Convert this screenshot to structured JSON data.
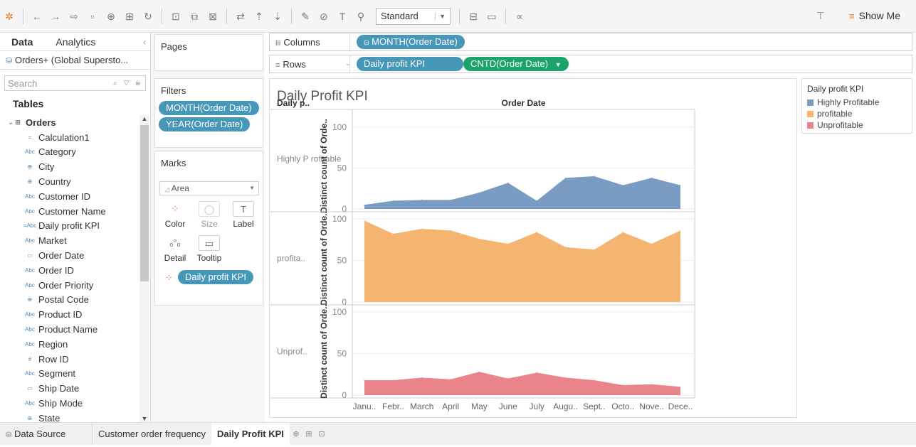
{
  "toolbar": {
    "fit_select": "Standard",
    "show_me_label": "Show Me"
  },
  "data_pane": {
    "tab_data": "Data",
    "tab_analytics": "Analytics",
    "data_source": "Orders+ (Global Supersto...",
    "search_placeholder": "Search",
    "tables_heading": "Tables",
    "fields": [
      {
        "label": "Orders",
        "icon": "table-icon",
        "group": true
      },
      {
        "label": "Calculation1",
        "icon": "calculated-field-icon"
      },
      {
        "label": "Category",
        "icon": "string-icon"
      },
      {
        "label": "City",
        "icon": "geo-icon"
      },
      {
        "label": "Country",
        "icon": "geo-icon"
      },
      {
        "label": "Customer ID",
        "icon": "string-icon"
      },
      {
        "label": "Customer Name",
        "icon": "string-icon"
      },
      {
        "label": "Daily profit KPI",
        "icon": "calc-string-icon"
      },
      {
        "label": "Market",
        "icon": "string-icon"
      },
      {
        "label": "Order Date",
        "icon": "date-icon"
      },
      {
        "label": "Order ID",
        "icon": "string-icon"
      },
      {
        "label": "Order Priority",
        "icon": "string-icon"
      },
      {
        "label": "Postal Code",
        "icon": "geo-icon"
      },
      {
        "label": "Product ID",
        "icon": "string-icon"
      },
      {
        "label": "Product Name",
        "icon": "string-icon"
      },
      {
        "label": "Region",
        "icon": "string-icon"
      },
      {
        "label": "Row ID",
        "icon": "number-icon"
      },
      {
        "label": "Segment",
        "icon": "string-icon"
      },
      {
        "label": "Ship Date",
        "icon": "date-icon"
      },
      {
        "label": "Ship Mode",
        "icon": "string-icon"
      },
      {
        "label": "State",
        "icon": "geo-icon"
      }
    ]
  },
  "pages": {
    "title": "Pages"
  },
  "filters": {
    "title": "Filters",
    "items": [
      "MONTH(Order Date)",
      "YEAR(Order Date)"
    ]
  },
  "marks": {
    "title": "Marks",
    "type": "Area",
    "buttons": {
      "color": "Color",
      "size": "Size",
      "label": "Label",
      "detail": "Detail",
      "tooltip": "Tooltip"
    },
    "color_field": "Daily profit KPI"
  },
  "columns_shelf": {
    "label": "Columns",
    "pills": [
      "MONTH(Order Date)"
    ]
  },
  "rows_shelf": {
    "label": "Rows",
    "pills": [
      "Daily profit KPI",
      "CNTD(Order Date)"
    ]
  },
  "viz": {
    "title": "Daily Profit KPI",
    "row_header": "Daily p..",
    "column_header": "Order Date",
    "axis_title": "Distinct count of Orde..",
    "row_labels": [
      "Highly P rofitable",
      "profita..",
      "Unprof.."
    ]
  },
  "legend": {
    "title": "Daily profit KPI",
    "items": [
      {
        "label": "Highly Profitable",
        "color": "#7b9cc2"
      },
      {
        "label": "profitable",
        "color": "#f5b46f"
      },
      {
        "label": "Unprofitable",
        "color": "#e9848a"
      }
    ]
  },
  "chart_data": {
    "type": "area",
    "categories": [
      "Janu..",
      "Febr..",
      "March",
      "April",
      "May",
      "June",
      "July",
      "Augu..",
      "Sept..",
      "Octo..",
      "Nove..",
      "Dece.."
    ],
    "xlabel": "Order Date",
    "ylabel": "Distinct count of Orde..",
    "ylim": [
      0,
      100
    ],
    "yticks": [
      0,
      50,
      100
    ],
    "series": [
      {
        "name": "Highly Profitable",
        "color": "#7b9cc2",
        "values": [
          5,
          10,
          11,
          11,
          20,
          32,
          10,
          38,
          40,
          29,
          38,
          29
        ]
      },
      {
        "name": "profitable",
        "color": "#f5b46f",
        "values": [
          98,
          82,
          88,
          86,
          76,
          70,
          84,
          66,
          63,
          84,
          70,
          86
        ]
      },
      {
        "name": "Unprofitable",
        "color": "#e9848a",
        "values": [
          18,
          18,
          21,
          19,
          28,
          20,
          27,
          21,
          18,
          12,
          13,
          10
        ]
      }
    ]
  },
  "bottom_tabs": {
    "data_source": "Data Source",
    "sheets": [
      "Customer order frequency",
      "Daily Profit KPI"
    ],
    "active": "Daily Profit KPI"
  }
}
